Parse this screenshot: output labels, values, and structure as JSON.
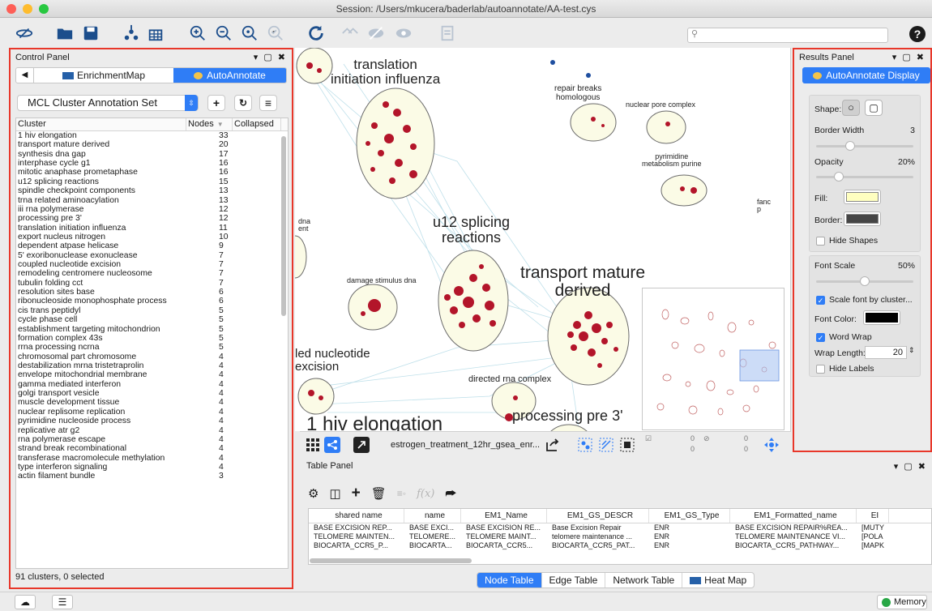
{
  "window": {
    "title": "Session: /Users/mkucera/baderlab/autoannotate/AA-test.cys"
  },
  "search": {
    "placeholder": ""
  },
  "control_panel": {
    "title": "Control Panel",
    "tabs": [
      "EnrichmentMap",
      "AutoAnnotate"
    ],
    "annotation_set": "MCL Cluster Annotation Set",
    "columns": [
      "Cluster",
      "Nodes",
      "Collapsed"
    ],
    "rows": [
      [
        "1 hiv elongation",
        "33"
      ],
      [
        "transport mature derived",
        "20"
      ],
      [
        "synthesis dna gap",
        "17"
      ],
      [
        "interphase cycle g1",
        "16"
      ],
      [
        "mitotic anaphase prometaphase",
        "16"
      ],
      [
        "u12 splicing reactions",
        "15"
      ],
      [
        "spindle checkpoint components",
        "13"
      ],
      [
        "trna related aminoacylation",
        "13"
      ],
      [
        "iii rna polymerase",
        "12"
      ],
      [
        "processing pre 3'",
        "12"
      ],
      [
        "translation initiation influenza",
        "11"
      ],
      [
        "export nucleus nitrogen",
        "10"
      ],
      [
        "dependent atpase helicase",
        "9"
      ],
      [
        "5' exoribonuclease exonuclease",
        "7"
      ],
      [
        "coupled nucleotide excision",
        "7"
      ],
      [
        "remodeling centromere nucleosome",
        "7"
      ],
      [
        "tubulin folding cct",
        "7"
      ],
      [
        "resolution sites base",
        "6"
      ],
      [
        "ribonucleoside monophosphate process",
        "6"
      ],
      [
        "cis trans peptidyl",
        "5"
      ],
      [
        "cycle phase cell",
        "5"
      ],
      [
        "establishment targeting mitochondrion",
        "5"
      ],
      [
        "formation complex 43s",
        "5"
      ],
      [
        "rrna processing ncrna",
        "5"
      ],
      [
        "chromosomal part chromosome",
        "4"
      ],
      [
        "destabilization mrna tristetraprolin",
        "4"
      ],
      [
        "envelope mitochondrial membrane",
        "4"
      ],
      [
        "gamma mediated interferon",
        "4"
      ],
      [
        "golgi transport vesicle",
        "4"
      ],
      [
        "muscle development tissue",
        "4"
      ],
      [
        "nuclear replisome replication",
        "4"
      ],
      [
        "pyrimidine nucleoside process",
        "4"
      ],
      [
        "replicative atr g2",
        "4"
      ],
      [
        "rna polymerase escape",
        "4"
      ],
      [
        "strand break recombinational",
        "4"
      ],
      [
        "transferase macromolecule methylation",
        "4"
      ],
      [
        "type interferon signaling",
        "4"
      ],
      [
        "actin filament bundle",
        "3"
      ]
    ],
    "status": "91 clusters, 0 selected"
  },
  "network": {
    "labels": {
      "translation": "translation\ninitiation influenza",
      "u12": "u12 splicing\nreactions",
      "transport": "transport mature\nderived",
      "excision": "led nucleotide\nexcision",
      "hiv": "1 hiv elongation",
      "processing": "processing pre 3'",
      "repair": "repair breaks\nhomologous",
      "pore": "nuclear pore complex",
      "pyrimidine": "pyrimidine\nmetabolism purine",
      "damage": "damage stimulus dna",
      "directed": "directed rna complex",
      "dna_left": "dna\nent",
      "fanc": "fanc\np"
    },
    "network_name": "estrogen_treatment_12hr_gsea_enr...",
    "mini_counts": [
      "0",
      "0",
      "0",
      "0"
    ]
  },
  "results_panel": {
    "title": "Results Panel",
    "header_button": "AutoAnnotate Display",
    "shape_label": "Shape:",
    "border_width_label": "Border Width",
    "border_width_value": "3",
    "border_width_level": 0.33,
    "opacity_label": "Opacity",
    "opacity_value": "20%",
    "opacity_level": 0.2,
    "fill_label": "Fill:",
    "fill_color": "#ffffc0",
    "border_label": "Border:",
    "border_color": "#454545",
    "hide_shapes": "Hide Shapes",
    "font_scale_label": "Font Scale",
    "font_scale_value": "50%",
    "font_scale_level": 0.5,
    "scale_font": "Scale font by cluster...",
    "font_color_label": "Font Color:",
    "font_color": "#000000",
    "word_wrap": "Word Wrap",
    "wrap_length_label": "Wrap Length:",
    "wrap_length_value": "20",
    "hide_labels": "Hide Labels"
  },
  "table_panel": {
    "title": "Table Panel",
    "columns": [
      "shared name",
      "name",
      "EM1_Name",
      "EM1_GS_DESCR",
      "EM1_GS_Type",
      "EM1_Formatted_name",
      "EI"
    ],
    "rows": [
      [
        "BASE EXCISION REP...",
        "BASE EXCI...",
        "BASE EXCISION RE...",
        "Base Excision Repair",
        "ENR",
        "BASE EXCISION REPAIR%REA...",
        "[MUTY"
      ],
      [
        "TELOMERE MAINTEN...",
        "TELOMERE...",
        "TELOMERE MAINT...",
        "telomere maintenance ...",
        "ENR",
        "TELOMERE MAINTENANCE VI...",
        "[POLA"
      ],
      [
        "BIOCARTA_CCR5_P...",
        "BIOCARTA...",
        "BIOCARTA_CCR5...",
        "BIOCARTA_CCR5_PAT...",
        "ENR",
        "BIOCARTA_CCR5_PATHWAY...",
        "[MAPK"
      ]
    ],
    "tabs": [
      "Node Table",
      "Edge Table",
      "Network Table",
      "Heat Map"
    ]
  },
  "status_bar": {
    "memory": "Memory"
  },
  "colors": {
    "accent": "#2f7df6",
    "highlight": "#e8372a",
    "node": "#b3152a",
    "cluster_fill": "#fbfbe6"
  }
}
